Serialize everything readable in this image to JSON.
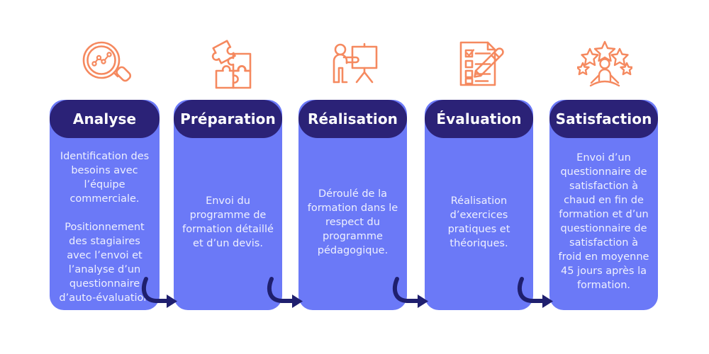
{
  "page": {
    "background_color": "#ffffff",
    "type": "process-infographic",
    "step_count": 5
  },
  "palette": {
    "card_body": "#6b79f7",
    "card_header": "#2b2277",
    "icon": "#f5895f",
    "arrow": "#1f1f6e",
    "header_text": "#ffffff",
    "body_text": "#eef0fe"
  },
  "steps": [
    {
      "icon_name": "magnifier-chart-icon",
      "title": "Analyse",
      "body": "Identification des besoins avec l’équipe commerciale.\n\nPositionnement des stagiaires avec l’envoi et l’analyse d’un questionnaire d’auto-évaluation"
    },
    {
      "icon_name": "puzzle-pieces-icon",
      "title": "Préparation",
      "body": "Envoi du programme de formation détaillé et d’un devis."
    },
    {
      "icon_name": "trainer-whiteboard-icon",
      "title": "Réalisation",
      "body": "Déroulé de la formation dans le respect du programme pédagogique."
    },
    {
      "icon_name": "checklist-pencil-icon",
      "title": "Évaluation",
      "body": "Réalisation d’exercices pratiques et théoriques."
    },
    {
      "icon_name": "person-stars-icon",
      "title": "Satisfaction",
      "body": "Envoi d’un questionnaire de satisfaction à chaud en fin de formation et d’un questionnaire de satisfaction à froid en moyenne 45 jours après la formation."
    }
  ],
  "connectors": [
    {
      "name": "arrow-1-to-2"
    },
    {
      "name": "arrow-2-to-3"
    },
    {
      "name": "arrow-3-to-4"
    },
    {
      "name": "arrow-4-to-5"
    }
  ]
}
